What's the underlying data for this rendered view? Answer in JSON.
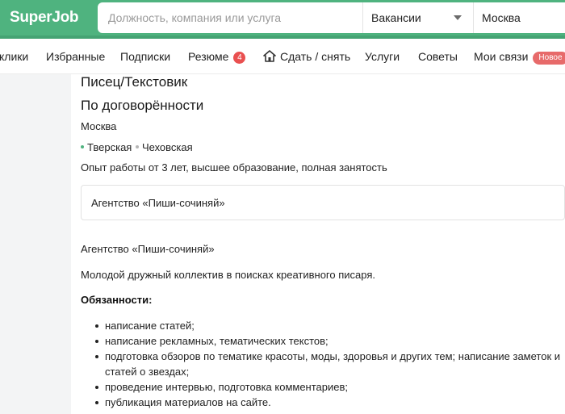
{
  "header": {
    "logo": "SuperJob",
    "search_placeholder": "Должность, компания или услуга",
    "type_select": "Вакансии",
    "city": "Москва",
    "colors": {
      "brand": "#4fb37f",
      "badge": "#e95050"
    }
  },
  "nav": {
    "items": [
      {
        "label": "клики"
      },
      {
        "label": "Избранные"
      },
      {
        "label": "Подписки"
      },
      {
        "label": "Резюме",
        "badge": "4"
      },
      {
        "label": "Сдать / снять",
        "icon": "house-icon"
      },
      {
        "label": "Услуги"
      },
      {
        "label": "Советы"
      },
      {
        "label": "Мои связи",
        "badge": "Новое"
      }
    ]
  },
  "vacancy": {
    "title": "Писец/Текстовик",
    "salary": "По договорённости",
    "city": "Москва",
    "metro": [
      {
        "name": "Тверская",
        "color": "#4fb37f"
      },
      {
        "name": "Чеховская",
        "color": "#b5b5b5"
      }
    ],
    "requirements": "Опыт работы от 3 лет, высшее образование, полная занятость",
    "company": "Агентство «Пиши-сочиняй»"
  },
  "description": {
    "company_line": "Агентство «Пиши-сочиняй»",
    "intro": "Молодой дружный коллектив в поисках креативного писаря.",
    "duties_heading": "Обязанности:",
    "duties": [
      "написание статей;",
      "написание рекламных, тематических текстов;",
      "подготовка обзоров по тематике красоты, моды, здоровья и других тем; написание заметок и статей о звездах;",
      "проведение интервью, подготовка комментариев;",
      "публикация материалов на сайте."
    ]
  }
}
